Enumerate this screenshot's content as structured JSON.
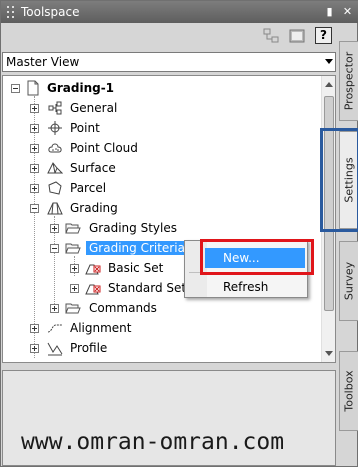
{
  "window": {
    "title": "Toolspace"
  },
  "toolbar": {
    "help_label": "?"
  },
  "view_select": {
    "value": "Master View"
  },
  "tree": {
    "root": "Grading-1",
    "nodes": [
      "General",
      "Point",
      "Point Cloud",
      "Surface",
      "Parcel",
      "Grading",
      "Grading Styles",
      "Grading Criteria Sets",
      "Basic Set",
      "Standard Set",
      "Commands",
      "Alignment",
      "Profile"
    ]
  },
  "context_menu": {
    "items": [
      "New...",
      "Refresh"
    ]
  },
  "side_tabs": [
    "Prospector",
    "Settings",
    "Survey",
    "Toolbox"
  ],
  "watermark": "www.omran-omran.com",
  "colors": {
    "highlight": "#3399ff",
    "annotation_red": "#e0151a",
    "annotation_blue": "#2a5a9e"
  }
}
